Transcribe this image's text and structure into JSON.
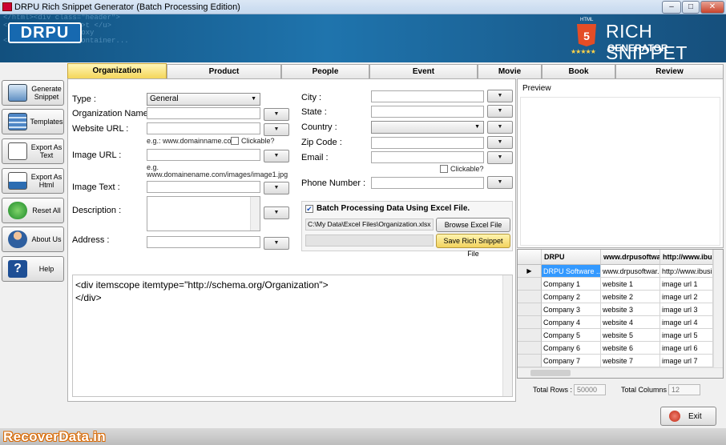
{
  "window": {
    "title": "DRPU Rich Snippet Generator (Batch Processing Edition)",
    "minimize": "–",
    "maximize": "□",
    "close": "✕"
  },
  "header": {
    "logo": "DRPU",
    "html5_badge": "5",
    "html5_small": "HTML",
    "product_title": "RICH SNIPPET",
    "product_subtitle": "GENERATOR",
    "stars": "★★★★★",
    "code_bg": "</html><div class=\"header\">\n<    89,999,186 <u>t </u>\n        ogged-in-boxy\n<       a_header_container..."
  },
  "sidebar": {
    "items": [
      {
        "label": "Generate Snippet",
        "icon": "generate-snippet-icon"
      },
      {
        "label": "Templates",
        "icon": "templates-icon"
      },
      {
        "label": "Export As Text",
        "icon": "export-text-icon"
      },
      {
        "label": "Export As Html",
        "icon": "export-html-icon"
      },
      {
        "label": "Reset All",
        "icon": "reset-icon"
      },
      {
        "label": "About Us",
        "icon": "about-us-icon"
      },
      {
        "label": "Help",
        "icon": "help-icon"
      }
    ]
  },
  "tabs": [
    "Organization",
    "Product",
    "People",
    "Event",
    "Movie",
    "Book",
    "Review"
  ],
  "form": {
    "type_label": "Type :",
    "type_value": "General",
    "org_name_label": "Organization Name :",
    "website_label": "Website URL :",
    "website_hint": "e.g.: www.domainname.com",
    "clickable": "Clickable?",
    "image_url_label": "Image URL :",
    "image_hint1": "e.g.",
    "image_hint2": "www.domainename.com/images/image1.jpg",
    "image_text_label": "Image Text :",
    "description_label": "Description :",
    "address_label": "Address :",
    "city_label": "City :",
    "state_label": "State :",
    "country_label": "Country :",
    "zip_label": "Zip Code :",
    "email_label": "Email :",
    "email_clickable": "Clickable?",
    "phone_label": "Phone Number :"
  },
  "batch": {
    "checkbox_label": "Batch Processing Data Using Excel File.",
    "checked_mark": "✔",
    "file_path": "C:\\My Data\\Excel Files\\Organization.xlsx",
    "browse_button": "Browse Excel File",
    "save_button": "Save Rich Snippet File"
  },
  "code_output": {
    "line1": "<div itemscope itemtype=\"http://schema.org/Organization\">",
    "line2": "</div>"
  },
  "preview": {
    "label": "Preview"
  },
  "grid": {
    "headers": [
      "DRPU",
      "www.drpusoftware.com",
      "http://www.ibusi..."
    ],
    "rows": [
      [
        "DRPU Software ...",
        "www.drpusoftwar...",
        "http://www.ibusi..."
      ],
      [
        "Company 1",
        "website 1",
        "image url 1"
      ],
      [
        "Company 2",
        "website 2",
        "image url 2"
      ],
      [
        "Company 3",
        "website 3",
        "image url 3"
      ],
      [
        "Company 4",
        "website 4",
        "image url 4"
      ],
      [
        "Company 5",
        "website 5",
        "image url 5"
      ],
      [
        "Company 6",
        "website 6",
        "image url 6"
      ],
      [
        "Company 7",
        "website 7",
        "image url 7"
      ]
    ],
    "current_row_marker": "▶"
  },
  "stats": {
    "total_rows_label": "Total Rows :",
    "total_rows": "50000",
    "total_columns_label": "Total Columns :",
    "total_columns": "12"
  },
  "exit": {
    "label": "Exit"
  },
  "watermark": {
    "text": "RecoverData.in"
  },
  "colors": {
    "active_tab": "#f4d65a",
    "header_blue": "#1f74ad",
    "watermark_orange": "#d96a05"
  }
}
